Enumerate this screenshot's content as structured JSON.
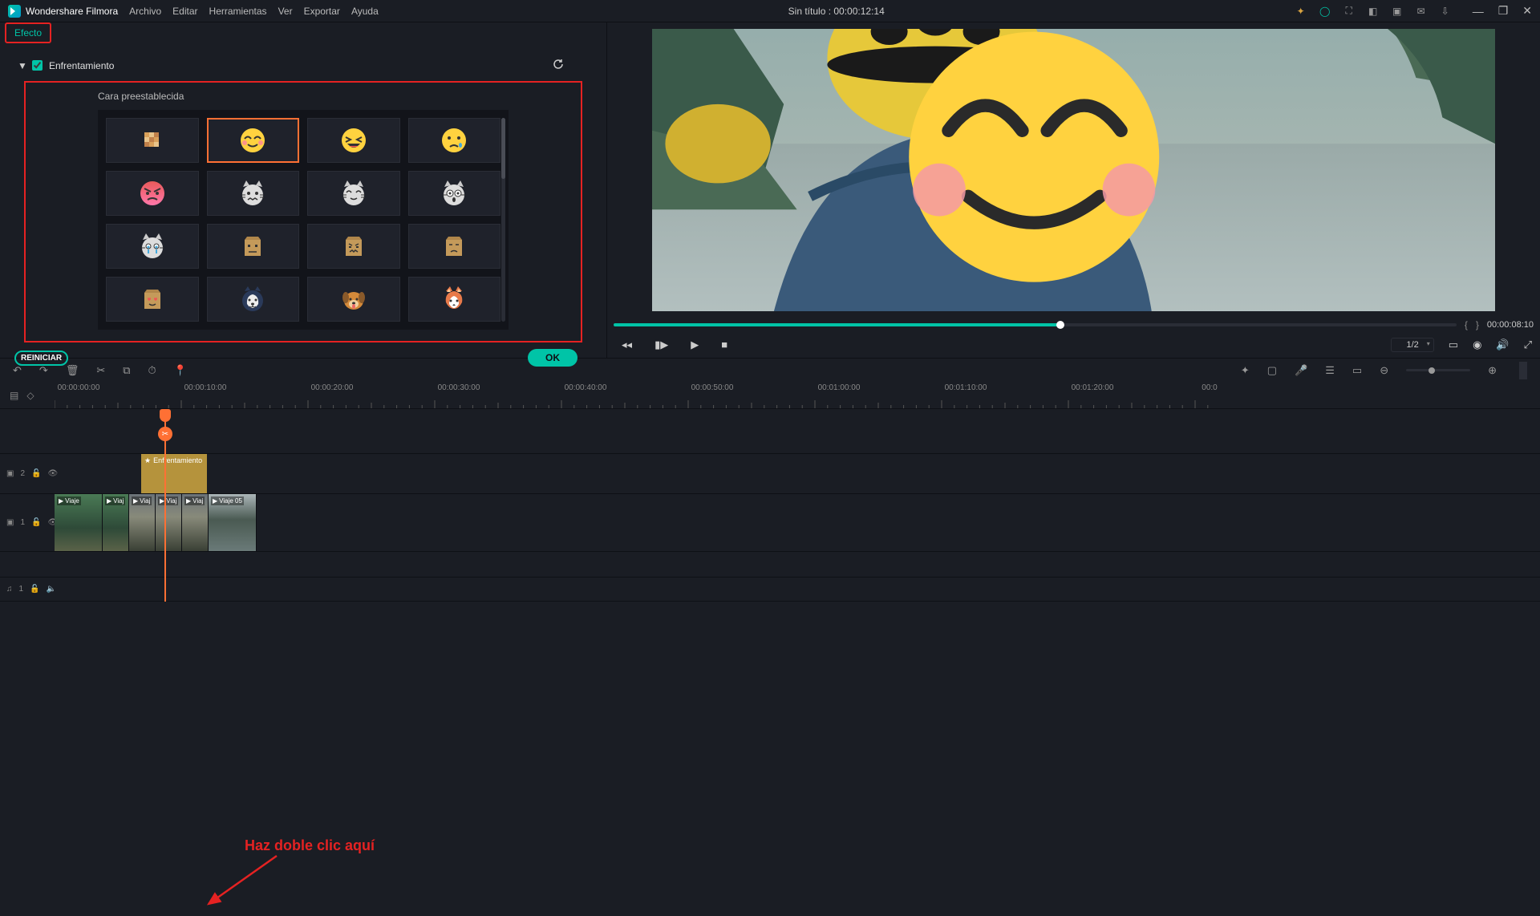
{
  "app_name": "Wondershare Filmora",
  "menu": {
    "items": [
      "Archivo",
      "Editar",
      "Herramientas",
      "Ver",
      "Exportar",
      "Ayuda"
    ]
  },
  "title": "Sin título : 00:00:12:14",
  "effect_panel": {
    "tab_label": "Efecto",
    "section_label": "Enfrentamiento",
    "preset_label": "Cara preestablecida",
    "preset_selected_index": 1,
    "reset_label": "REINICIAR",
    "ok_label": "OK"
  },
  "preview": {
    "timecode": "00:00:08:10",
    "page": "1/2"
  },
  "timeline": {
    "ruler_labels": [
      "00:00:00:00",
      "00:00:10:00",
      "00:00:20:00",
      "00:00:30:00",
      "00:00:40:00",
      "00:00:50:00",
      "00:01:00:00",
      "00:01:10:00",
      "00:01:20:00",
      "00:0"
    ],
    "effect_track_name": "2",
    "video_track_name": "1",
    "audio_track_name": "1",
    "effect_clip_label": "Enfrentamiento",
    "video_clips": [
      "Viaje",
      "Viaj",
      "Viaj",
      "Viaj",
      "Viaj",
      "Viaje 05"
    ]
  },
  "annotation_text": "Haz doble clic aquí"
}
